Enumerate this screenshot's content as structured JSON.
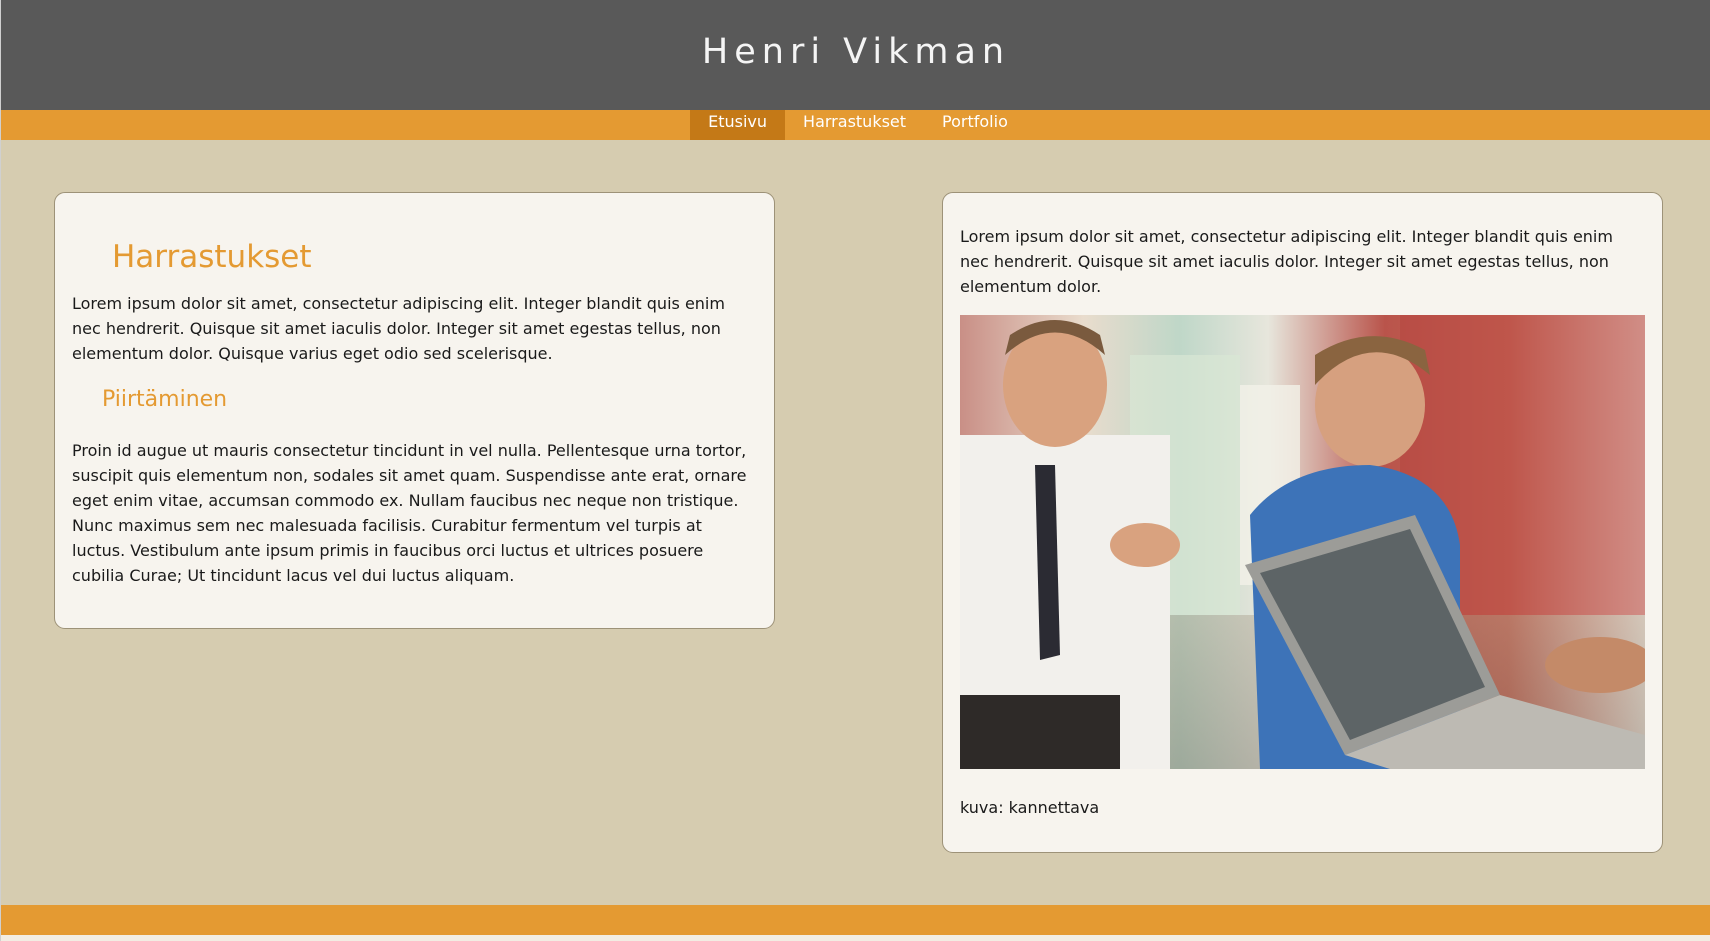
{
  "site": {
    "title": "Henri Vikman"
  },
  "nav": {
    "items": [
      {
        "label": "Etusivu",
        "active": true
      },
      {
        "label": "Harrastukset",
        "active": false
      },
      {
        "label": "Portfolio",
        "active": false
      }
    ]
  },
  "left_card": {
    "heading": "Harrastukset",
    "intro": "Lorem ipsum dolor sit amet, consectetur adipiscing elit. Integer blandit quis enim nec hendrerit. Quisque sit amet iaculis dolor. Integer sit amet egestas tellus, non elementum dolor. Quisque varius eget odio sed scelerisque.",
    "subheading": "Piirtäminen",
    "body": "Proin id augue ut mauris consectetur tincidunt in vel nulla. Pellentesque urna tortor, suscipit quis elementum non, sodales sit amet quam. Suspendisse ante erat, ornare eget enim vitae, accumsan commodo ex. Nullam faucibus nec neque non tristique. Nunc maximus sem nec malesuada facilisis. Curabitur fermentum vel turpis at luctus. Vestibulum ante ipsum primis in faucibus orci luctus et ultrices posuere cubilia Curae; Ut tincidunt lacus vel dui luctus aliquam."
  },
  "right_card": {
    "text": "Lorem ipsum dolor sit amet, consectetur adipiscing elit. Integer blandit quis enim nec hendrerit. Quisque sit amet iaculis dolor. Integer sit amet egestas tellus, non elementum dolor.",
    "caption": "kuva: kannettava"
  },
  "colors": {
    "header_bg": "#595959",
    "accent": "#e49a32",
    "nav_active": "#c47917",
    "page_bg": "#d6ccb0",
    "card_bg": "#f7f4ee"
  }
}
